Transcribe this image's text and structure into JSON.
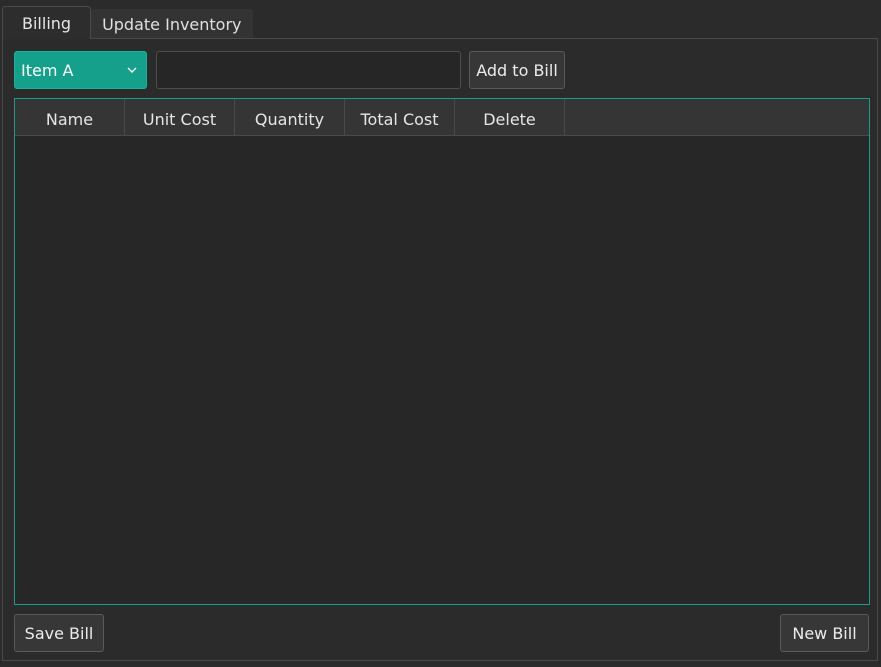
{
  "tabs": [
    {
      "label": "Billing",
      "active": true
    },
    {
      "label": "Update Inventory",
      "active": false
    }
  ],
  "billing": {
    "item_select": {
      "selected": "Item A"
    },
    "quantity_input": {
      "value": "",
      "placeholder": ""
    },
    "add_button_label": "Add to Bill",
    "table": {
      "columns": [
        "Name",
        "Unit Cost",
        "Quantity",
        "Total Cost",
        "Delete"
      ],
      "rows": []
    },
    "save_button_label": "Save Bill",
    "new_button_label": "New Bill"
  },
  "colors": {
    "accent": "#14a08a",
    "background": "#2b2b2b",
    "table_border": "#1a9c86"
  },
  "icons": {
    "combo_indicator": "chevron-down-icon"
  }
}
